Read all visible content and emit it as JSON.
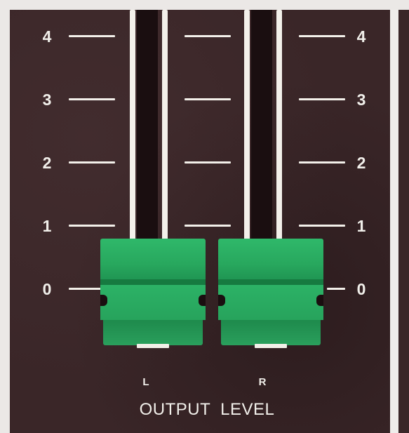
{
  "scale": {
    "marks_left": [
      "4",
      "3",
      "2",
      "1",
      "0"
    ],
    "marks_right": [
      "4",
      "3",
      "2",
      "1",
      "0"
    ]
  },
  "channels": [
    {
      "name": "L",
      "level": 0.0
    },
    {
      "name": "R",
      "level": 0.0
    }
  ],
  "caption": "OUTPUT  LEVEL",
  "colors": {
    "panel": "#3a2628",
    "fader_knob": "#28a85e",
    "markings": "#f1efea"
  }
}
